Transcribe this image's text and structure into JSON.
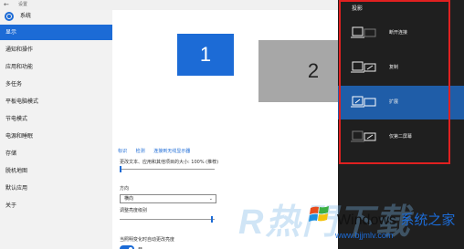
{
  "window": {
    "title": "设置"
  },
  "sidebar": {
    "app_title": "系统",
    "items": [
      {
        "label": "显示",
        "active": true
      },
      {
        "label": "通知和操作"
      },
      {
        "label": "应用和功能"
      },
      {
        "label": "多任务"
      },
      {
        "label": "平板电脑模式"
      },
      {
        "label": "节电模式"
      },
      {
        "label": "电源和睡眠"
      },
      {
        "label": "存储"
      },
      {
        "label": "脱机地图"
      },
      {
        "label": "默认应用"
      },
      {
        "label": "关于"
      }
    ]
  },
  "display": {
    "monitors": [
      "1",
      "2"
    ],
    "links": [
      "标识",
      "检测",
      "连接到无线显示器"
    ],
    "scale_label": "更改文本、应用和其他项目的大小: 100% (推荐)",
    "orientation_label": "方向",
    "orientation_value": "横向",
    "brightness_label": "调整亮度级别",
    "auto_brightness_label": "当照明变化时自动更改亮度",
    "toggle_state": "开"
  },
  "project": {
    "title": "投影",
    "options": [
      {
        "label": "断开连接",
        "icon": "pc-screen-only-icon"
      },
      {
        "label": "复制",
        "icon": "duplicate-icon"
      },
      {
        "label": "扩展",
        "icon": "extend-icon",
        "selected": true
      },
      {
        "label": "仅第二屏幕",
        "icon": "second-screen-only-icon"
      }
    ]
  },
  "watermark": {
    "big_text": "R热門下载",
    "brand_en": "Windows",
    "brand_cn": "系统之家",
    "url": "www.bjjmlv.com"
  },
  "colors": {
    "accent": "#1c6bd6",
    "highlight_border": "#e02020",
    "pane_bg": "#1f1f1f",
    "selected_option": "#1f5da8"
  }
}
